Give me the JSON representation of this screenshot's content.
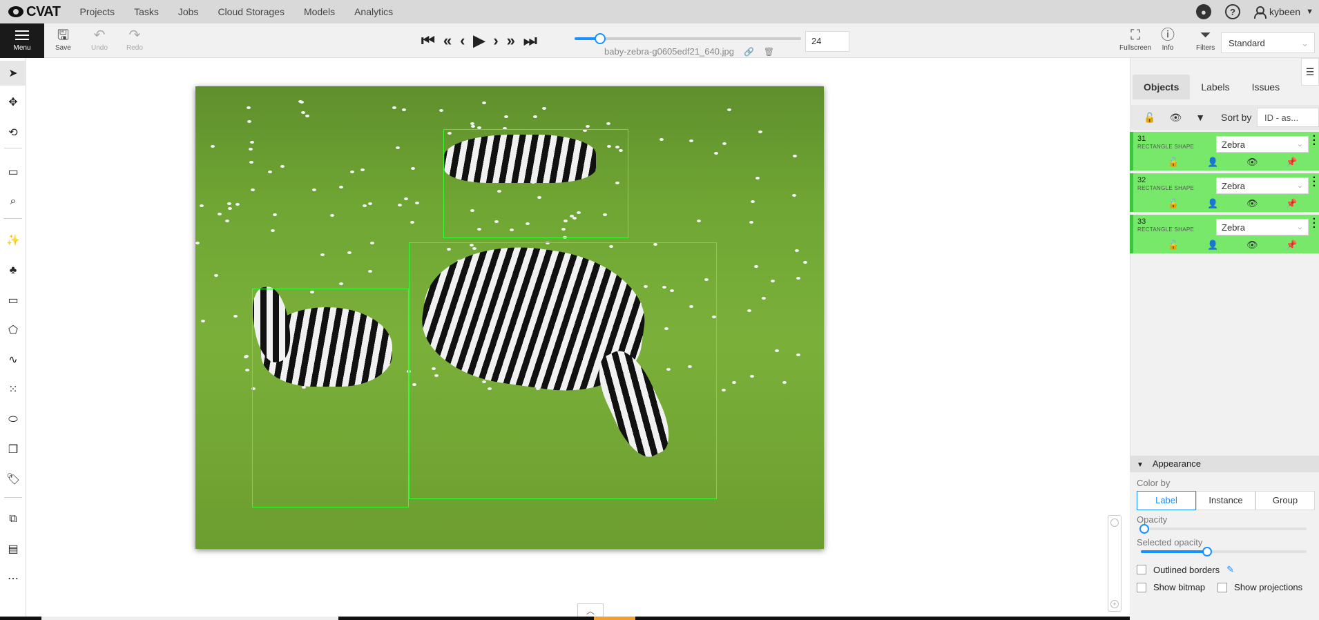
{
  "app": {
    "logo": "CVAT"
  },
  "nav": {
    "items": [
      "Projects",
      "Tasks",
      "Jobs",
      "Cloud Storages",
      "Models",
      "Analytics"
    ]
  },
  "user": {
    "name": "kybeen"
  },
  "help_icon_text": "?",
  "toolbar": {
    "menu_label": "Menu",
    "save_label": "Save",
    "undo_label": "Undo",
    "redo_label": "Redo",
    "frame_number": "24",
    "filename": "baby-zebra-g0605edf21_640.jpg",
    "fullscreen_label": "Fullscreen",
    "info_label": "Info",
    "filters_label": "Filters",
    "workspace": "Standard",
    "frame_slider_progress": 0.11
  },
  "sidebar": {
    "tabs": [
      "Objects",
      "Labels",
      "Issues"
    ],
    "sort_label": "Sort by",
    "sort_value": "ID - as...",
    "objects": [
      {
        "id": "31",
        "type": "RECTANGLE SHAPE",
        "label": "Zebra"
      },
      {
        "id": "32",
        "type": "RECTANGLE SHAPE",
        "label": "Zebra"
      },
      {
        "id": "33",
        "type": "RECTANGLE SHAPE",
        "label": "Zebra"
      }
    ]
  },
  "appearance": {
    "title": "Appearance",
    "color_by_label": "Color by",
    "color_by_options": [
      "Label",
      "Instance",
      "Group"
    ],
    "color_by_selected": "Label",
    "opacity_label": "Opacity",
    "opacity_value": 0.02,
    "selected_opacity_label": "Selected opacity",
    "selected_opacity_value": 0.4,
    "outlined_borders_label": "Outlined borders",
    "show_bitmap_label": "Show bitmap",
    "show_projections_label": "Show projections"
  },
  "colors": {
    "accent": "#1890ff",
    "bbox": "#31ff31",
    "object_row": "#78e86a"
  }
}
